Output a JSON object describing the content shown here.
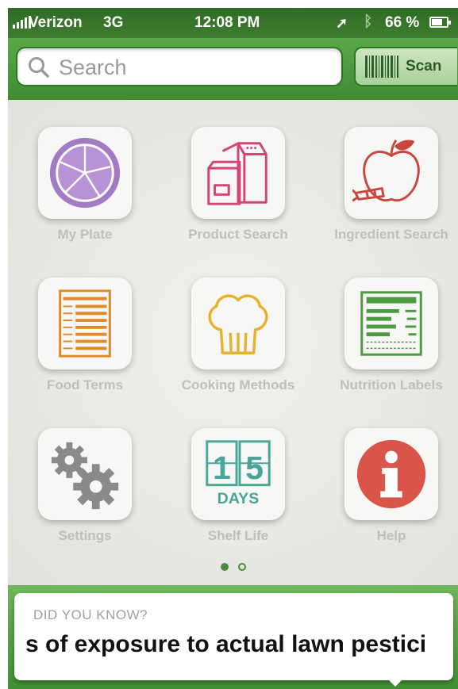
{
  "status_bar": {
    "carrier": "Verizon",
    "network": "3G",
    "time": "12:08 PM",
    "battery": "66 %",
    "battery_level": 0.66,
    "icons": [
      "signal-icon",
      "location-arrow-icon",
      "bluetooth-icon",
      "battery-icon"
    ]
  },
  "search": {
    "placeholder": "Search",
    "value": ""
  },
  "scan_button": {
    "label": "Scan",
    "icon": "barcode-icon"
  },
  "grid": {
    "items": [
      {
        "label": "My Plate",
        "icon": "plate-icon"
      },
      {
        "label": "Product Search",
        "icon": "product-packages-icon"
      },
      {
        "label": "Ingredient Search",
        "icon": "apple-carrot-icon"
      },
      {
        "label": "Food Terms",
        "icon": "glossary-list-icon"
      },
      {
        "label": "Cooking Methods",
        "icon": "chef-hat-icon"
      },
      {
        "label": "Nutrition Labels",
        "icon": "nutrition-label-icon"
      },
      {
        "label": "Settings",
        "icon": "gears-icon"
      },
      {
        "label": "Shelf Life",
        "icon": "calendar-days-icon",
        "calendar_digits": [
          "1",
          "5"
        ],
        "calendar_caption": "DAYS"
      },
      {
        "label": "Help",
        "icon": "info-icon"
      }
    ]
  },
  "pagination": {
    "current": 1,
    "total": 2
  },
  "did_you_know": {
    "heading": "DID YOU KNOW?",
    "text": "s of exposure to actual lawn pestici"
  },
  "colors": {
    "brand_green": "#3f8c33",
    "status_bar_green": "#2f6b24",
    "plate_purple": "#a27bc4",
    "product_pink": "#d3447a",
    "apple_red": "#c9473d",
    "terms_orange": "#e08a2a",
    "chef_yellow": "#e8b12a",
    "label_green": "#4e9a43",
    "gear_gray": "#8a8a8a",
    "shelf_teal": "#4aa59a",
    "help_red": "#d9554a"
  }
}
